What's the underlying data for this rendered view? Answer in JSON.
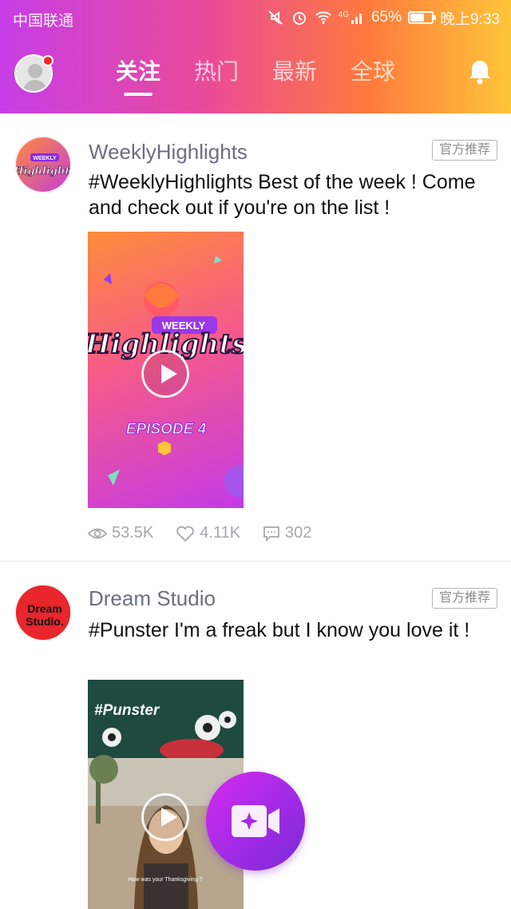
{
  "status_bar": {
    "carrier": "中国联通",
    "network_type": "4G",
    "battery": "65%",
    "battery_level": 0.65,
    "time": "晚上9:33"
  },
  "header": {
    "tabs": [
      {
        "label": "关注",
        "active": true
      },
      {
        "label": "热门",
        "active": false
      },
      {
        "label": "最新",
        "active": false
      },
      {
        "label": "全球",
        "active": false
      }
    ],
    "bell_icon": "bell-icon",
    "profile_icon": "user-avatar-icon"
  },
  "posts": [
    {
      "author": "WeeklyHighlights",
      "badge": "官方推荐",
      "caption": "#WeeklyHighlights  Best of the week ! Come and check out if  you're on the list !",
      "avatar_text": [
        "WEEKLY",
        "Highlights"
      ],
      "thumbnail_text": [
        "WEEKLY",
        "Highlights",
        "EPISODE 4"
      ],
      "views": "53.5K",
      "likes": "4.11K",
      "comments": "302"
    },
    {
      "author": "Dream Studio",
      "badge": "官方推荐",
      "caption": "#Punster  I'm a freak but I know you love it !",
      "avatar_text": [
        "Dream",
        "Studio."
      ],
      "thumbnail_text": [
        "#Punster",
        "How was your Thanksgiving ?"
      ]
    }
  ],
  "fab": {
    "icon": "video-camera-sparkle-icon"
  },
  "colors": {
    "header_gradient": [
      "#c63ee6",
      "#e94a9a",
      "#ff7a3c",
      "#ffc53a"
    ],
    "fab_gradient": [
      "#d62af0",
      "#7b2ad8"
    ],
    "name_color": "#6b6f80",
    "stat_color": "#a7a7ad"
  }
}
